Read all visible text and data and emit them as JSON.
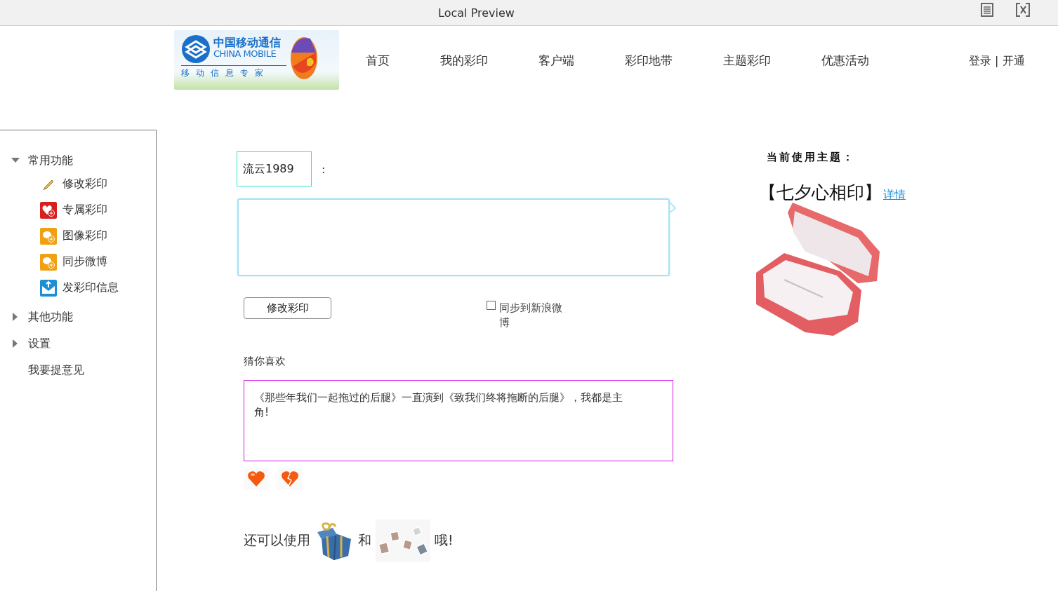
{
  "window": {
    "title": "Local Preview"
  },
  "header": {
    "logo": {
      "name_cn": "中国移动通信",
      "name_en": "CHINA MOBILE",
      "slogan": "移动信息专家"
    },
    "nav": [
      {
        "label": "首页"
      },
      {
        "label": "我的彩印"
      },
      {
        "label": "客户端"
      },
      {
        "label": "彩印地带"
      },
      {
        "label": "主题彩印"
      },
      {
        "label": "优惠活动"
      }
    ],
    "account": "登录 | 开通"
  },
  "sidebar": {
    "items": [
      {
        "label": "常用功能",
        "kind": "group",
        "expanded": true,
        "children": [
          {
            "label": "修改彩印",
            "kind": "pencil"
          },
          {
            "label": "专属彩印",
            "kind": "heart"
          },
          {
            "label": "图像彩印",
            "kind": "chat"
          },
          {
            "label": "同步微博",
            "kind": "chat"
          },
          {
            "label": "发彩印信息",
            "kind": "mail"
          }
        ]
      },
      {
        "label": "其他功能",
        "kind": "group",
        "expanded": false
      },
      {
        "label": "设置",
        "kind": "group",
        "expanded": false
      },
      {
        "label": "我要提意见",
        "kind": "link"
      }
    ]
  },
  "editor": {
    "user": "流云1989",
    "separator": ":",
    "submit": "修改彩印",
    "sync": {
      "label": "同步到新浪微博",
      "checked": false
    }
  },
  "suggestions": {
    "title": "猜你喜欢",
    "text": "《那些年我们一起拖过的后腿》一直演到《致我们终将拖断的后腿》，我都是主角!"
  },
  "also": {
    "before": "还可以使用",
    "middle": "和",
    "after": "哦!"
  },
  "theme": {
    "label": "当前使用主题：",
    "name": "【七夕心相印】",
    "link": "详情"
  }
}
